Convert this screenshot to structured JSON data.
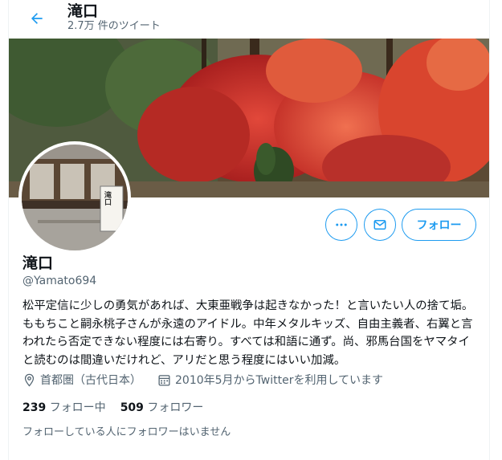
{
  "header": {
    "title": "滝口",
    "tweet_count": "2.7万 件のツイート",
    "back_icon": "arrow-left-icon"
  },
  "profile": {
    "name": "滝口",
    "handle": "@Yamato694",
    "bio": "松平定信に少しの勇気があれば、大東亜戦争は起きなかった！と言いたい人の捨て垢。ももちこと嗣永桃子さんが永遠のアイドル。中年メタルキッズ、自由主義者、右翼と言われたら否定できない程度には右寄り。すべては和語に通ず。尚、邪馬台国をヤマタイと読むのは間違いだけれど、アリだと思う程度にはいい加減。",
    "location": "首都圏（古代日本）",
    "joined": "2010年5月からTwitterを利用しています",
    "following_count": "239",
    "following_label": "フォロー中",
    "followers_count": "509",
    "followers_label": "フォロワー",
    "followers_note": "フォローしている人にフォロワーはいません",
    "avatar_sign": "滝口"
  },
  "actions": {
    "more_icon": "more-dots-icon",
    "message_icon": "mail-icon",
    "follow_label": "フォロー"
  },
  "colors": {
    "accent": "#1d9bf0",
    "secondary_text": "#536471",
    "primary_text": "#0f1419"
  }
}
